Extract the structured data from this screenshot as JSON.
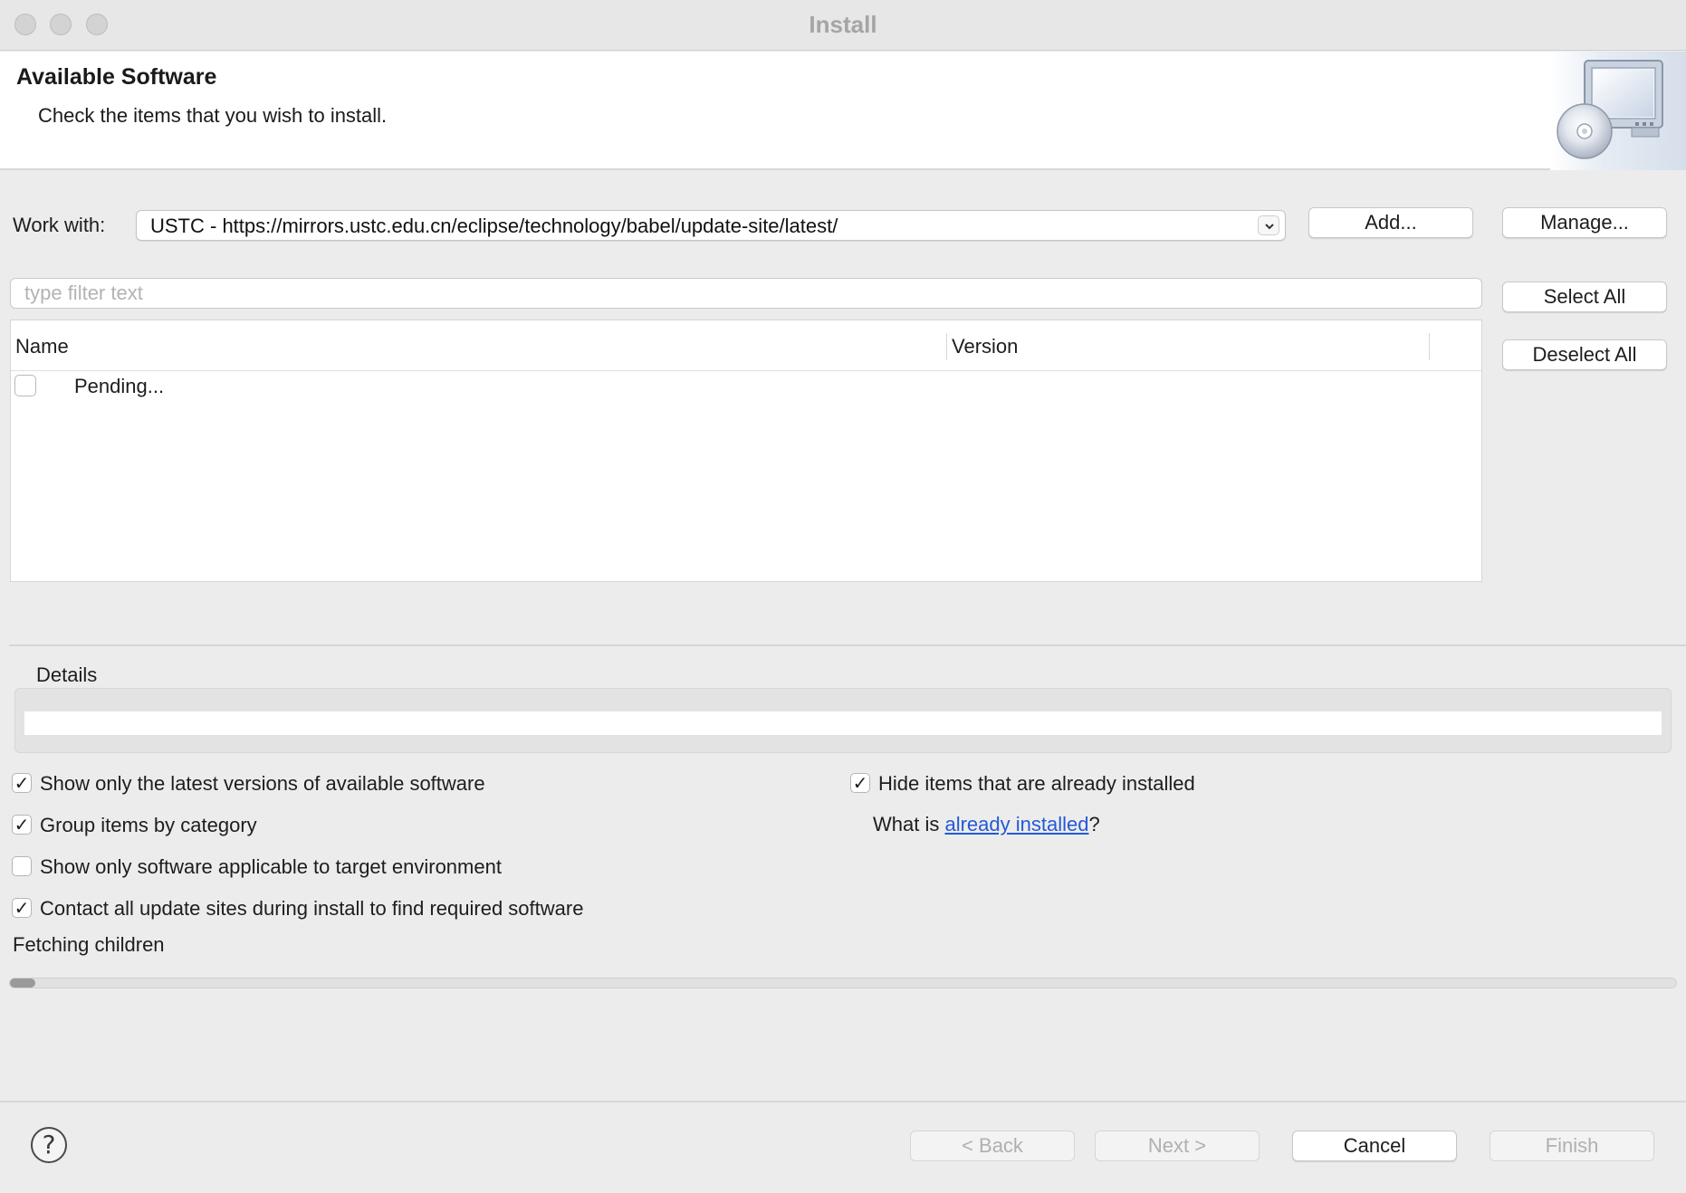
{
  "window": {
    "title": "Install"
  },
  "banner": {
    "title": "Available Software",
    "description": "Check the items that you wish to install."
  },
  "work_with": {
    "label": "Work with:",
    "value": "USTC - https://mirrors.ustc.edu.cn/eclipse/technology/babel/update-site/latest/",
    "add_label": "Add...",
    "manage_label": "Manage..."
  },
  "filter": {
    "placeholder": "type filter text",
    "value": ""
  },
  "side_buttons": {
    "select_all": "Select All",
    "deselect_all": "Deselect All"
  },
  "table": {
    "columns": [
      "Name",
      "Version"
    ],
    "rows": [
      {
        "name": "Pending...",
        "version": "",
        "checked": false
      }
    ]
  },
  "details": {
    "label": "Details"
  },
  "options": {
    "latest_versions": {
      "label": "Show only the latest versions of available software",
      "checked": true
    },
    "group_by_category": {
      "label": "Group items by category",
      "checked": true
    },
    "applicable_only": {
      "label": "Show only software applicable to target environment",
      "checked": false
    },
    "contact_all_sites": {
      "label": "Contact all update sites during install to find required software",
      "checked": true
    },
    "hide_installed": {
      "label": "Hide items that are already installed",
      "checked": true
    },
    "what_is_prefix": "What is ",
    "what_is_link": "already installed",
    "what_is_suffix": "?"
  },
  "status": {
    "text": "Fetching children",
    "progress_fraction": 0.015
  },
  "footer": {
    "help_icon": "question-mark-icon",
    "back_label": "< Back",
    "next_label": "Next >",
    "cancel_label": "Cancel",
    "finish_label": "Finish"
  },
  "colors": {
    "link": "#2459d6",
    "disabled_text": "#b0b0b0"
  }
}
